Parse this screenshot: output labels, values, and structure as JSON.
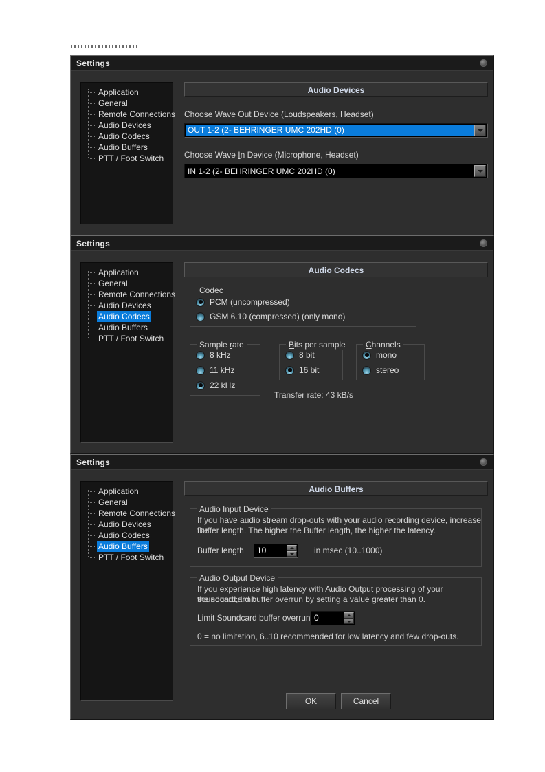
{
  "window": {
    "title": "Settings",
    "close_icon": "close-circle-icon"
  },
  "sidebar_items": [
    "Application",
    "General",
    "Remote Connections",
    "Audio Devices",
    "Audio Codecs",
    "Audio Buffers",
    "PTT / Foot Switch"
  ],
  "colors": {
    "selection_blue": "#0a7cdb",
    "dialog_bg": "#2e2e2e",
    "pane_header_text": "#cfd8e8",
    "text": "#d8d8d8"
  },
  "panels": {
    "audio_devices": {
      "selected_sidebar": "Audio Devices",
      "header": "Audio Devices",
      "wave_out": {
        "label_pre": "Choose ",
        "label_mnemonic": "W",
        "label_post": "ave Out Device (Loudspeakers, Headset)",
        "value": "OUT 1-2 (2- BEHRINGER UMC 202HD (0)"
      },
      "wave_in": {
        "label_pre": "Choose Wave ",
        "label_mnemonic": "I",
        "label_post": "n Device (Microphone, Headset)",
        "value": "IN 1-2 (2- BEHRINGER UMC 202HD  (0)"
      }
    },
    "audio_codecs": {
      "selected_sidebar": "Audio Codecs",
      "header": "Audio Codecs",
      "codec_group": {
        "title_pre": "Co",
        "title_mnemonic": "d",
        "title_post": "ec",
        "options": [
          {
            "label": "PCM (uncompressed)",
            "selected": true
          },
          {
            "label": "GSM 6.10 (compressed) (only mono)",
            "selected": false
          }
        ]
      },
      "sample_rate_group": {
        "title_pre": "Sample ",
        "title_mnemonic": "r",
        "title_post": "ate",
        "options": [
          {
            "label": "8 kHz",
            "selected": false
          },
          {
            "label": "11 kHz",
            "selected": false
          },
          {
            "label": "22 kHz",
            "selected": true
          }
        ]
      },
      "bits_group": {
        "title_pre": "",
        "title_mnemonic": "B",
        "title_post": "its per sample",
        "options": [
          {
            "label": "8 bit",
            "selected": false
          },
          {
            "label": "16 bit",
            "selected": true
          }
        ]
      },
      "channels_group": {
        "title_pre": "",
        "title_mnemonic": "C",
        "title_post": "hannels",
        "options": [
          {
            "label": "mono",
            "selected": true
          },
          {
            "label": "stereo",
            "selected": false
          }
        ]
      },
      "transfer_rate": "Transfer rate: 43 kB/s"
    },
    "audio_buffers": {
      "selected_sidebar": "Audio Buffers",
      "header": "Audio Buffers",
      "input_group": {
        "title": "Audio Input Device",
        "description_line1": "If you have audio stream drop-outs with your audio recording device, increase the",
        "description_line2": "Buffer length. The higher the Buffer length, the higher the latency.",
        "field_label": "Buffer length",
        "field_value": "10",
        "field_suffix": "in msec (10..1000)"
      },
      "output_group": {
        "title": "Audio Output Device",
        "description_line1": "If you experience high latency with Audio Output processing of your soundcard, limit",
        "description_line2": "the soundcard buffer overrun by setting a value greater than 0.",
        "field_label": "Limit Soundcard buffer overrun",
        "field_value": "0",
        "note": "0 = no limitation, 6..10 recommended for low latency and few drop-outs."
      },
      "buttons": {
        "ok_pre": "",
        "ok_mnemonic": "O",
        "ok_post": "K",
        "cancel_pre": "",
        "cancel_mnemonic": "C",
        "cancel_post": "ancel"
      }
    }
  }
}
